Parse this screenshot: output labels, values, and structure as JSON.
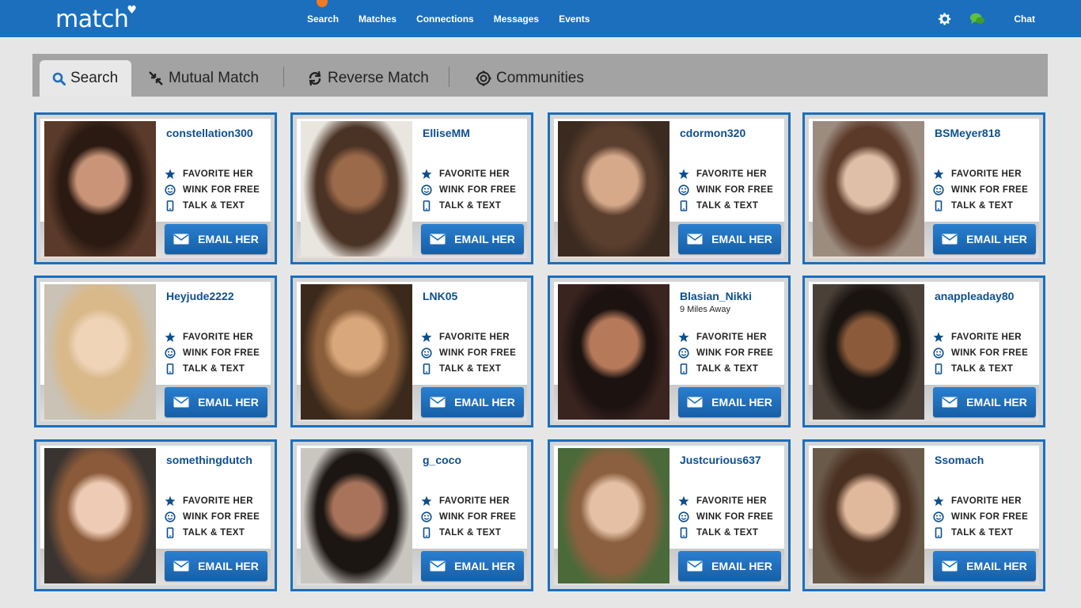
{
  "app": {
    "logo": "match"
  },
  "nav": [
    "Search",
    "Matches",
    "Connections",
    "Messages",
    "Events"
  ],
  "top_right": {
    "chat_label": "Chat"
  },
  "tabs": [
    {
      "label": "Search",
      "icon": "search-icon"
    },
    {
      "label": "Mutual Match",
      "icon": "mutual-match-icon"
    },
    {
      "label": "Reverse Match",
      "icon": "reverse-match-icon"
    },
    {
      "label": "Communities",
      "icon": "communities-icon"
    }
  ],
  "actions": {
    "favorite": "FAVORITE HER",
    "wink": "WINK FOR FREE",
    "talk": "TALK & TEXT",
    "email": "EMAIL HER"
  },
  "profiles": [
    {
      "username": "constellation300",
      "distance": ""
    },
    {
      "username": "ElliseMM",
      "distance": ""
    },
    {
      "username": "cdormon320",
      "distance": ""
    },
    {
      "username": "BSMeyer818",
      "distance": ""
    },
    {
      "username": "Heyjude2222",
      "distance": ""
    },
    {
      "username": "LNK05",
      "distance": ""
    },
    {
      "username": "Blasian_Nikki",
      "distance": "9 Miles Away"
    },
    {
      "username": "anappleaday80",
      "distance": ""
    },
    {
      "username": "somethingdutch",
      "distance": ""
    },
    {
      "username": "g_coco",
      "distance": ""
    },
    {
      "username": "Justcurious637",
      "distance": ""
    },
    {
      "username": "Ssomach",
      "distance": ""
    }
  ],
  "colors": {
    "brand": "#1b6fbd",
    "notification": "#f47a21",
    "username": "#0d4f8f",
    "chat_icon": "#5fc23a"
  }
}
